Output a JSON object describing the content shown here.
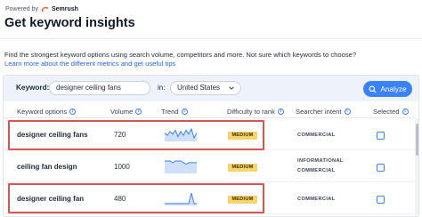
{
  "header": {
    "powered_by": "Powered by",
    "brand": "Semrush",
    "title": "Get keyword insights"
  },
  "intro": {
    "text": "Find the strongest keyword options using search volume, competitors and more. Not sure which keywords to choose?",
    "link": "Learn more about the different metrics and get useful tips"
  },
  "search": {
    "keyword_label": "Keyword:",
    "keyword_value": "designer ceiling fans",
    "in_label": "in:",
    "country": "United States",
    "analyze_label": "Analyze"
  },
  "table": {
    "columns": [
      "Keyword options",
      "Volume",
      "Trend",
      "Difficulty to rank",
      "Searcher intent",
      "Selected"
    ],
    "rows": [
      {
        "keyword": "designer ceiling fans",
        "volume": "720",
        "trend": [
          6,
          4,
          7,
          5,
          8,
          3,
          7,
          4,
          8,
          5,
          9,
          2,
          6
        ],
        "difficulty": "MEDIUM",
        "intent": [
          "COMMERCIAL"
        ],
        "selected": false,
        "highlighted": true
      },
      {
        "keyword": "ceiling fan design",
        "volume": "1000",
        "trend": [
          7,
          7,
          7,
          6,
          7,
          7,
          7,
          6,
          5,
          6,
          6,
          6,
          6
        ],
        "difficulty": "MEDIUM",
        "intent": [
          "INFORMATIONAL",
          "COMMERCIAL"
        ],
        "selected": false,
        "highlighted": false
      },
      {
        "keyword": "designer ceiling fan",
        "volume": "480",
        "trend": [
          1,
          1,
          1,
          1,
          1,
          1,
          1,
          1,
          1,
          1,
          12,
          1,
          1
        ],
        "difficulty": "MEDIUM",
        "intent": [
          "COMMERCIAL"
        ],
        "selected": false,
        "highlighted": true
      }
    ]
  },
  "colors": {
    "accent": "#3b82f6",
    "badge": "#f9d36b",
    "highlight": "#d9534f",
    "trend": "#3b82f6"
  }
}
